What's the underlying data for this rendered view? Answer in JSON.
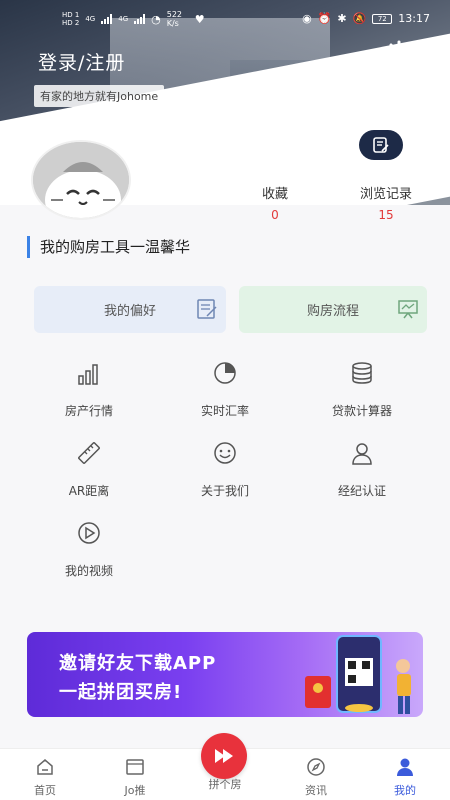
{
  "status": {
    "net_labels": [
      "HD 1",
      "HD 2"
    ],
    "sig": "4G",
    "speed": "522 K/s",
    "battery": "72",
    "time": "13:17"
  },
  "header": {
    "login": "登录/注册",
    "tagline": "有家的地方就有Johome"
  },
  "stats": [
    {
      "label": "收藏",
      "value": "0"
    },
    {
      "label": "浏览记录",
      "value": "15"
    }
  ],
  "section": {
    "title": "我的购房工具一温馨华"
  },
  "cards": {
    "preference": "我的偏好",
    "process": "购房流程"
  },
  "tools": [
    {
      "label": "房产行情",
      "icon": "bar-chart-icon"
    },
    {
      "label": "实时汇率",
      "icon": "pie-chart-icon"
    },
    {
      "label": "贷款计算器",
      "icon": "database-icon"
    },
    {
      "label": "AR距离",
      "icon": "ruler-icon"
    },
    {
      "label": "关于我们",
      "icon": "smile-icon"
    },
    {
      "label": "经纪认证",
      "icon": "user-icon"
    },
    {
      "label": "我的视频",
      "icon": "play-icon"
    }
  ],
  "banner": {
    "line1": "邀请好友下载APP",
    "line2": "一起拼团买房!"
  },
  "tabs": {
    "home": "首页",
    "jo": "Jo推",
    "center": "拼个房",
    "news": "资讯",
    "mine": "我的"
  },
  "colors": {
    "accent": "#3b82e6",
    "red": "#e8323c",
    "active_tab": "#3b5bdb"
  }
}
